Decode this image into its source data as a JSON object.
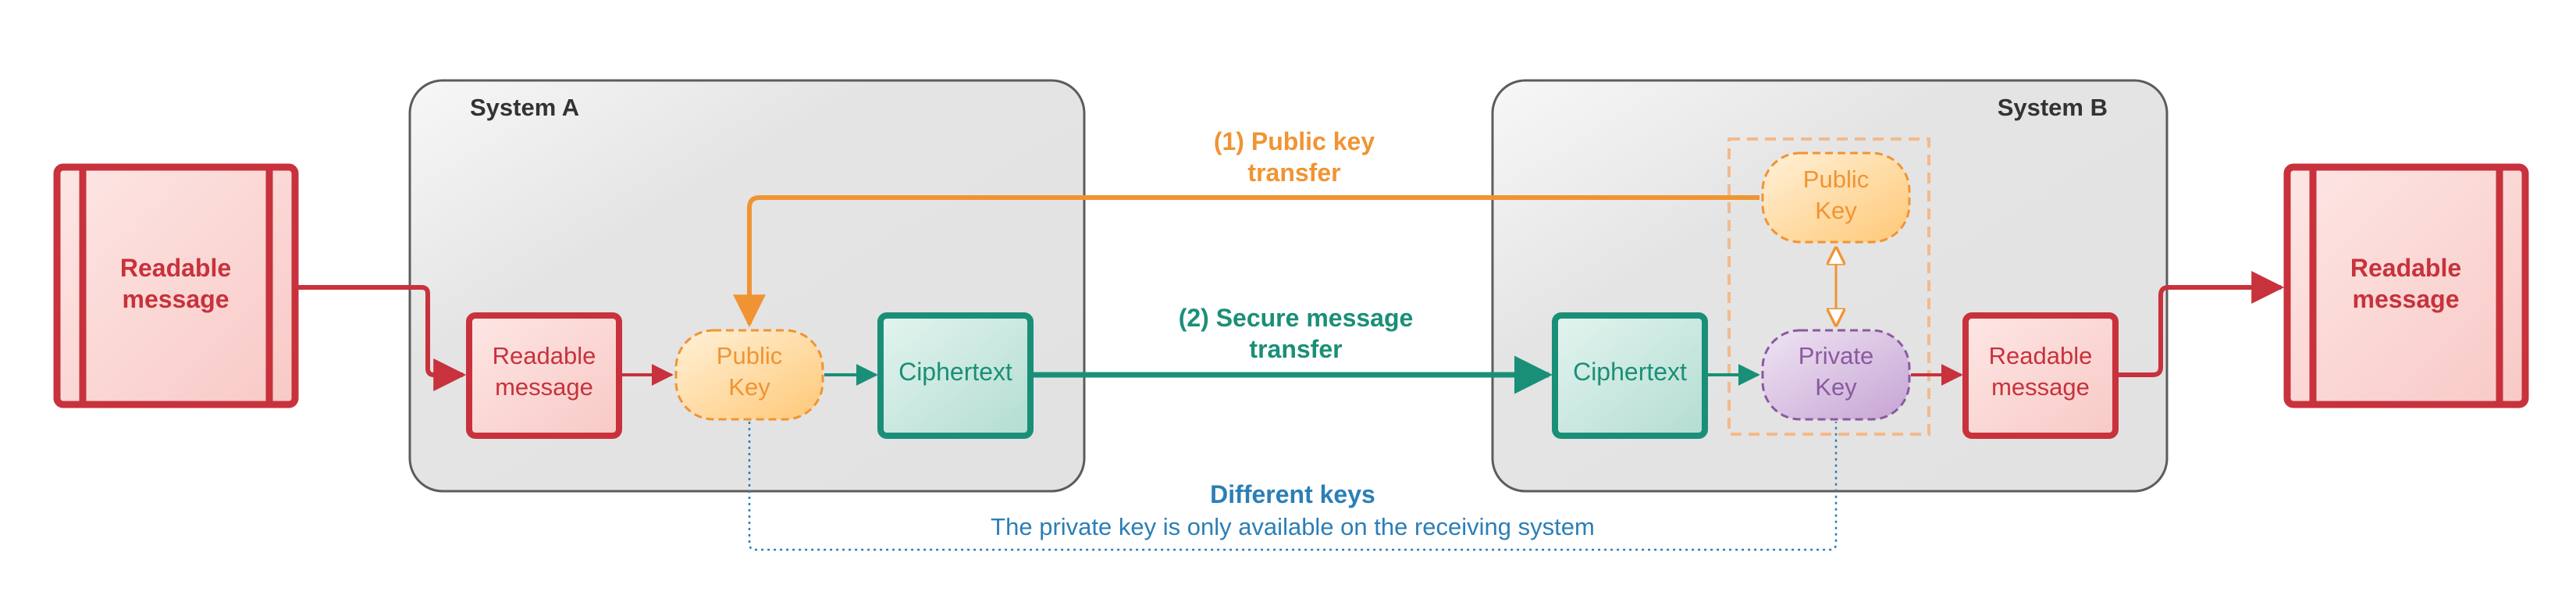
{
  "systems": {
    "a": {
      "title": "System A"
    },
    "b": {
      "title": "System B"
    }
  },
  "sender": {
    "outer_message": {
      "line1": "Readable",
      "line2": "message"
    },
    "inner_message": {
      "line1": "Readable",
      "line2": "message"
    },
    "public_key": {
      "line1": "Public",
      "line2": "Key"
    },
    "ciphertext": "Ciphertext"
  },
  "receiver": {
    "public_key": {
      "line1": "Public",
      "line2": "Key"
    },
    "private_key": {
      "line1": "Private",
      "line2": "Key"
    },
    "ciphertext": "Ciphertext",
    "inner_message": {
      "line1": "Readable",
      "line2": "message"
    },
    "outer_message": {
      "line1": "Readable",
      "line2": "message"
    }
  },
  "transfers": {
    "public_key": {
      "line1": "(1) Public key",
      "line2": "transfer"
    },
    "secure_message": {
      "line1": "(2) Secure message",
      "line2": "transfer"
    }
  },
  "note": {
    "title": "Different keys",
    "text": "The private key is only available on the receiving system"
  },
  "colors": {
    "message_red": "#c8323c",
    "message_fill": "#fbd3d1",
    "public_key_orange": "#f09433",
    "public_key_fill": "#ffd79a",
    "cipher_teal": "#1a8f78",
    "cipher_fill": "#bfe3d8",
    "private_purple": "#8a5a9e",
    "private_fill": "#d9c1e3",
    "note_blue": "#2b7fb6",
    "system_border": "#5c5c5c",
    "system_fill": "#e6e6e6"
  }
}
